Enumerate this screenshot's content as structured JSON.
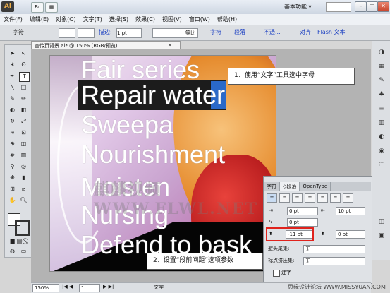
{
  "app": {
    "logo": "Ai",
    "workspace_label": "基本功能 ▾"
  },
  "window_controls": {
    "minimize": "–",
    "restore": "□",
    "close": "✕"
  },
  "menubar": {
    "items": [
      "文件(F)",
      "编辑(E)",
      "对象(O)",
      "文字(T)",
      "选择(S)",
      "效果(C)",
      "视图(V)",
      "窗口(W)",
      "帮助(H)"
    ]
  },
  "controlbar": {
    "context_label": "字符",
    "stroke_label": "描边:",
    "stroke_value": "1 pt",
    "stroke_style": "等比",
    "character_link": "字符",
    "paragraph_link": "段落",
    "opacity_link": "不透...",
    "align_link": "对齐",
    "flash_link": "Flash 文本"
  },
  "document": {
    "tab_title": "宣传页背景.ai* @ 150% (RGB/预览)",
    "tab_close": "×"
  },
  "artwork": {
    "lines": [
      "Fair series",
      "Repair water",
      "Sweepa",
      "Nourishment",
      "Moisten",
      "Nursing",
      "Defend to bask"
    ],
    "watermark": "麒麟视频WWW.FLWL.NET"
  },
  "callouts": {
    "step1": "1、使用“文字”工具选中字母",
    "step2": "2、设置“段前间距”选项参数"
  },
  "paragraph_panel": {
    "tabs": [
      "字符",
      "◇段落",
      "OpenType"
    ],
    "left_indent": "0 pt",
    "right_indent": "10 pt",
    "first_line_indent": "0 pt",
    "space_before": "-11 pt",
    "space_after": "0 pt",
    "kinsoku_label": "避头尾集:",
    "kinsoku_value": "无",
    "mojikumi_label": "标点挤压集:",
    "mojikumi_value": "无",
    "hyphenate_label": "连字"
  },
  "statusbar": {
    "zoom": "150%",
    "page": "1",
    "status_text": "文字"
  },
  "site_watermark": "思缘设计论坛 WWW.MISSYUAN.COM",
  "colors": {
    "accent_red": "#e0231d",
    "selection_blue": "#2a69c9"
  }
}
